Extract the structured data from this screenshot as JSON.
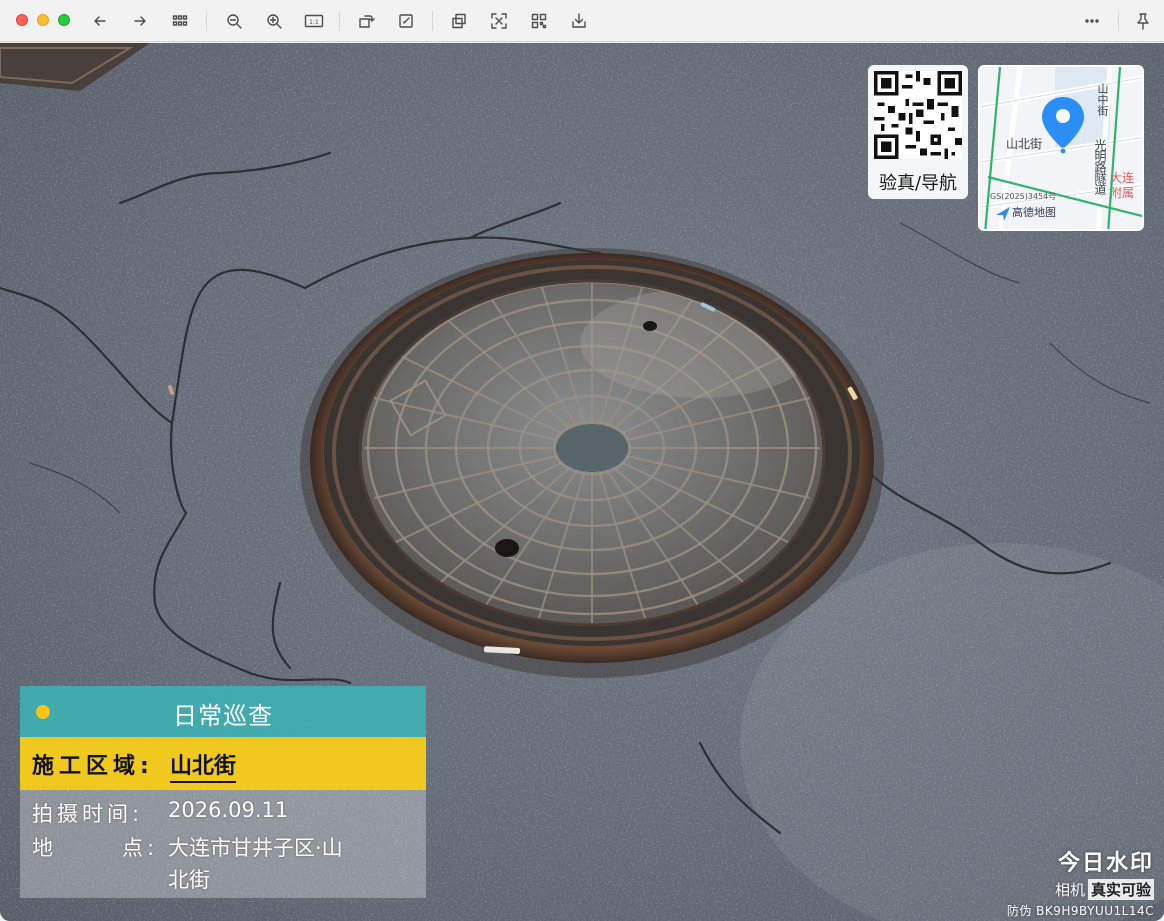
{
  "toolbar": {
    "buttons": [
      {
        "name": "back",
        "icon": "arrow-left-icon"
      },
      {
        "name": "forward",
        "icon": "arrow-right-icon"
      },
      {
        "name": "grid-view",
        "icon": "grid-icon"
      },
      {
        "name": "zoom-out",
        "icon": "zoom-out-icon"
      },
      {
        "name": "zoom-in",
        "icon": "zoom-in-icon"
      },
      {
        "name": "actual-size",
        "icon": "actual-size-icon"
      },
      {
        "name": "rotate",
        "icon": "rotate-icon"
      },
      {
        "name": "edit",
        "icon": "edit-icon"
      },
      {
        "name": "copy",
        "icon": "copy-icon"
      },
      {
        "name": "scan",
        "icon": "scan-icon"
      },
      {
        "name": "qr",
        "icon": "qr-icon"
      },
      {
        "name": "save",
        "icon": "download-icon"
      },
      {
        "name": "more",
        "icon": "more-icon"
      },
      {
        "name": "pin",
        "icon": "pin-icon"
      }
    ],
    "zoom_label": "1:1"
  },
  "badge": {
    "qr_label": "验真/导航",
    "map": {
      "street_left": "山北街",
      "street_top": "山中街",
      "street_right": "光明路隧道",
      "district": "大连附属",
      "gs_code": "GS(2025)3454号",
      "provider": "高德地图"
    }
  },
  "watermark": {
    "title": "日常巡查",
    "area_label": "施工区域:",
    "area_value": "山北街",
    "time_label": "拍摄时间:",
    "time_value": "2026.09.11",
    "place_label": "地",
    "place_label2": "点:",
    "place_value_line1": "大连市甘井子区·山",
    "place_value_line2": "北街"
  },
  "brand": {
    "name": "今日水印",
    "sub_prefix": "相机",
    "sub_tag": "真实可验",
    "code": "防伪 BK9H9BYUU1L14C"
  },
  "colors": {
    "teal": "#3eb0b2",
    "yellow": "#f6cc1b",
    "asphalt": "#596370"
  }
}
